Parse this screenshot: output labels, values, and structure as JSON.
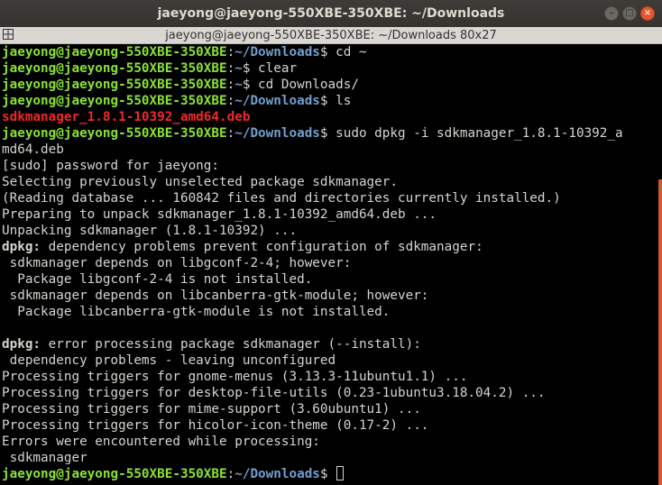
{
  "window": {
    "title": "jaeyong@jaeyong-550XBE-350XBE: ~/Downloads",
    "tab_title": "jaeyong@jaeyong-550XBE-350XBE: ~/Downloads 80x27",
    "buttons": {
      "minimize": "–",
      "maximize": "□",
      "close": "×"
    }
  },
  "colors": {
    "user": "#8ae234",
    "path": "#729fcf",
    "text": "#d3d7cf",
    "error_file": "#ef2929",
    "scrollbar": "#d15a25"
  },
  "terminal": {
    "prompt_user": "jaeyong@jaeyong-550XBE-350XBE",
    "lines": [
      {
        "path": "~/Downloads",
        "cmd": "$ cd ~"
      },
      {
        "path": "~",
        "cmd": "$ clear"
      },
      {
        "path": "~",
        "cmd": "$ cd Downloads/"
      },
      {
        "path": "~/Downloads",
        "cmd": "$ ls"
      },
      {
        "text": "sdkmanager_1.8.1-10392_amd64.deb"
      },
      {
        "path": "~/Downloads",
        "cmd": "$ sudo dpkg -i sdkmanager_1.8.1-10392_a"
      },
      {
        "text": "md64.deb"
      },
      {
        "text": "[sudo] password for jaeyong:"
      },
      {
        "text": "Selecting previously unselected package sdkmanager."
      },
      {
        "text": "(Reading database ... 160842 files and directories currently installed.)"
      },
      {
        "text": "Preparing to unpack sdkmanager_1.8.1-10392_amd64.deb ..."
      },
      {
        "text": "Unpacking sdkmanager (1.8.1-10392) ..."
      },
      {
        "bold": "dpkg:",
        "text": " dependency problems prevent configuration of sdkmanager:"
      },
      {
        "text": " sdkmanager depends on libgconf-2-4; however:"
      },
      {
        "text": "  Package libgconf-2-4 is not installed."
      },
      {
        "text": " sdkmanager depends on libcanberra-gtk-module; however:"
      },
      {
        "text": "  Package libcanberra-gtk-module is not installed."
      },
      {
        "text": ""
      },
      {
        "bold": "dpkg:",
        "text": " error processing package sdkmanager (--install):"
      },
      {
        "text": " dependency problems - leaving unconfigured"
      },
      {
        "text": "Processing triggers for gnome-menus (3.13.3-11ubuntu1.1) ..."
      },
      {
        "text": "Processing triggers for desktop-file-utils (0.23-1ubuntu3.18.04.2) ..."
      },
      {
        "text": "Processing triggers for mime-support (3.60ubuntu1) ..."
      },
      {
        "text": "Processing triggers for hicolor-icon-theme (0.17-2) ..."
      },
      {
        "text": "Errors were encountered while processing:"
      },
      {
        "text": " sdkmanager"
      },
      {
        "path": "~/Downloads",
        "cmd": "$ "
      }
    ]
  }
}
